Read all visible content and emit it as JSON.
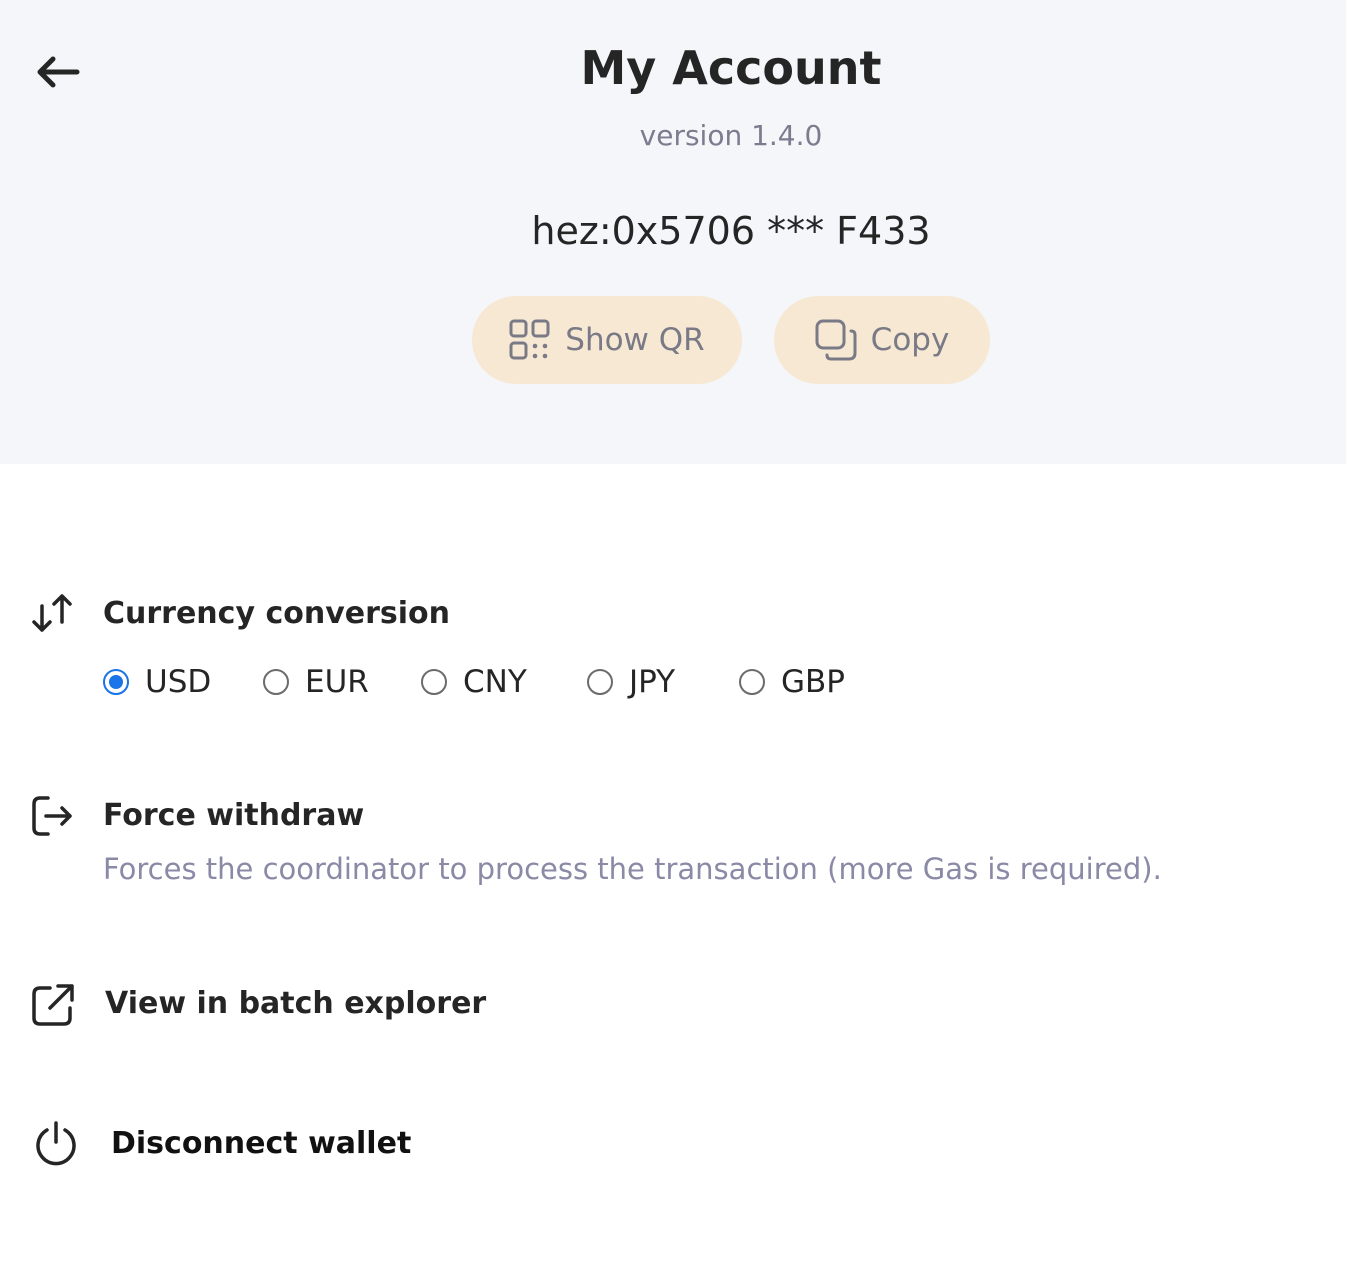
{
  "header": {
    "title": "My Account",
    "version": "version 1.4.0",
    "address": "hez:0x5706 *** F433",
    "show_qr_label": "Show QR",
    "copy_label": "Copy"
  },
  "currency": {
    "title": "Currency conversion",
    "selected": "USD",
    "options": [
      "USD",
      "EUR",
      "CNY",
      "JPY",
      "GBP"
    ]
  },
  "force_withdraw": {
    "title": "Force withdraw",
    "description": "Forces the coordinator to process the transaction (more Gas is required)."
  },
  "batch_explorer": {
    "title": "View in batch explorer"
  },
  "disconnect": {
    "title": "Disconnect wallet"
  },
  "colors": {
    "header_bg": "#f5f6fa",
    "pill_bg": "#f6e8d3",
    "accent_radio": "#1a73e8",
    "muted_text": "#8a89a6"
  },
  "icons": {
    "back": "arrow-left-icon",
    "qr": "qr-code-icon",
    "copy": "copy-icon",
    "currency": "swap-arrows-icon",
    "withdraw": "exit-icon",
    "explorer": "external-link-icon",
    "disconnect": "power-icon"
  }
}
